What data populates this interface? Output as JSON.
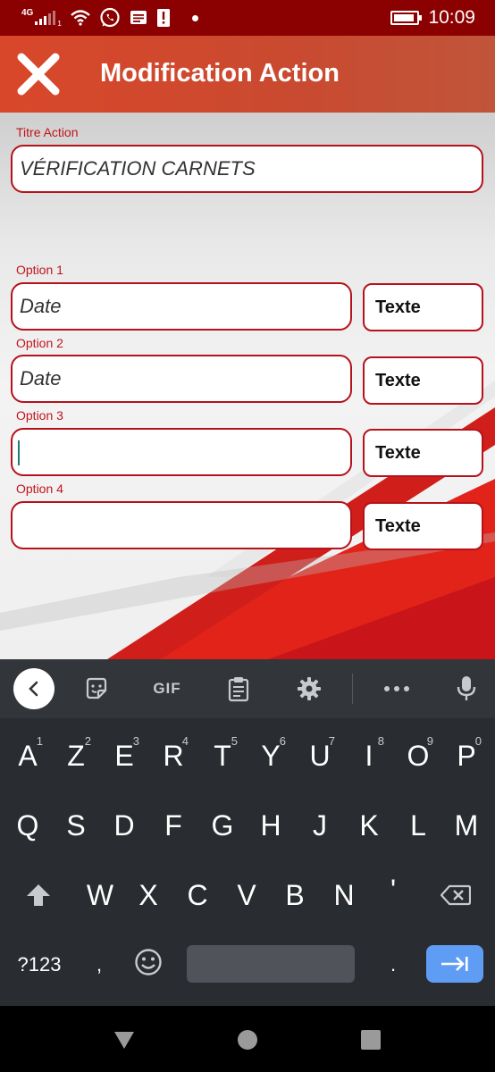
{
  "status_bar": {
    "network": "4G",
    "sim_slot": "1",
    "time": "10:09",
    "battery_level": 0.9
  },
  "app_bar": {
    "title": "Modification Action",
    "close_icon": "close-icon"
  },
  "form": {
    "title_label": "Titre Action",
    "title_value": "VÉRIFICATION CARNETS",
    "options": [
      {
        "label": "Option 1",
        "value": "Date",
        "type_button": "Texte"
      },
      {
        "label": "Option 2",
        "value": "Date",
        "type_button": "Texte"
      },
      {
        "label": "Option 3",
        "value": "",
        "type_button": "Texte"
      },
      {
        "label": "Option 4",
        "value": "",
        "type_button": "Texte"
      }
    ]
  },
  "keyboard": {
    "toolbar": {
      "gif_label": "GIF"
    },
    "rows": [
      [
        {
          "char": "A",
          "hint": "1"
        },
        {
          "char": "Z",
          "hint": "2"
        },
        {
          "char": "E",
          "hint": "3"
        },
        {
          "char": "R",
          "hint": "4"
        },
        {
          "char": "T",
          "hint": "5"
        },
        {
          "char": "Y",
          "hint": "6"
        },
        {
          "char": "U",
          "hint": "7"
        },
        {
          "char": "I",
          "hint": "8"
        },
        {
          "char": "O",
          "hint": "9"
        },
        {
          "char": "P",
          "hint": "0"
        }
      ],
      [
        "Q",
        "S",
        "D",
        "F",
        "G",
        "H",
        "J",
        "K",
        "L",
        "M"
      ],
      [
        "W",
        "X",
        "C",
        "V",
        "B",
        "N",
        "'"
      ]
    ],
    "symbols_key": "?123",
    "comma_key": ",",
    "period_key": "."
  },
  "colors": {
    "status_bar": "#8b0000",
    "app_bar": "#d9472a",
    "field_border": "#b5121b",
    "label": "#c0141b",
    "keyboard_bg": "#292c30",
    "enter_key": "#5f9df5"
  }
}
